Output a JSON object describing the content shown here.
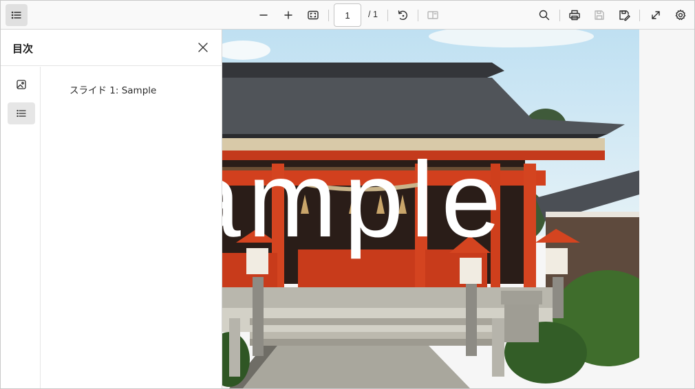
{
  "toolbar": {
    "page_current": "1",
    "page_total": "/ 1",
    "buttons": [
      {
        "icon": "outline-list-icon",
        "state": "active"
      },
      {
        "icon": "zoom-out-icon"
      },
      {
        "icon": "zoom-in-icon"
      },
      {
        "icon": "fit-page-icon"
      },
      {
        "icon": "rotate-icon"
      },
      {
        "icon": "page-view-icon",
        "state": "disabled"
      },
      {
        "icon": "search-icon"
      },
      {
        "icon": "print-icon"
      },
      {
        "icon": "save-icon",
        "state": "disabled"
      },
      {
        "icon": "save-as-icon"
      },
      {
        "icon": "fullscreen-icon"
      },
      {
        "icon": "settings-icon"
      }
    ]
  },
  "sidebar": {
    "title": "目次",
    "rail": [
      {
        "icon": "thumbnails-icon"
      },
      {
        "icon": "outline-list-icon",
        "state": "active"
      }
    ],
    "outline_items": [
      {
        "label": "スライド 1: Sample"
      }
    ]
  },
  "document": {
    "watermark_text": "Sample",
    "visible_text": "ample"
  },
  "colors": {
    "toolbar_bg": "#f9f9f9",
    "panel_bg": "#ffffff",
    "active_bg": "#e0e0e0",
    "shrine_red": "#d2401e",
    "roof": "#3d3f42"
  }
}
